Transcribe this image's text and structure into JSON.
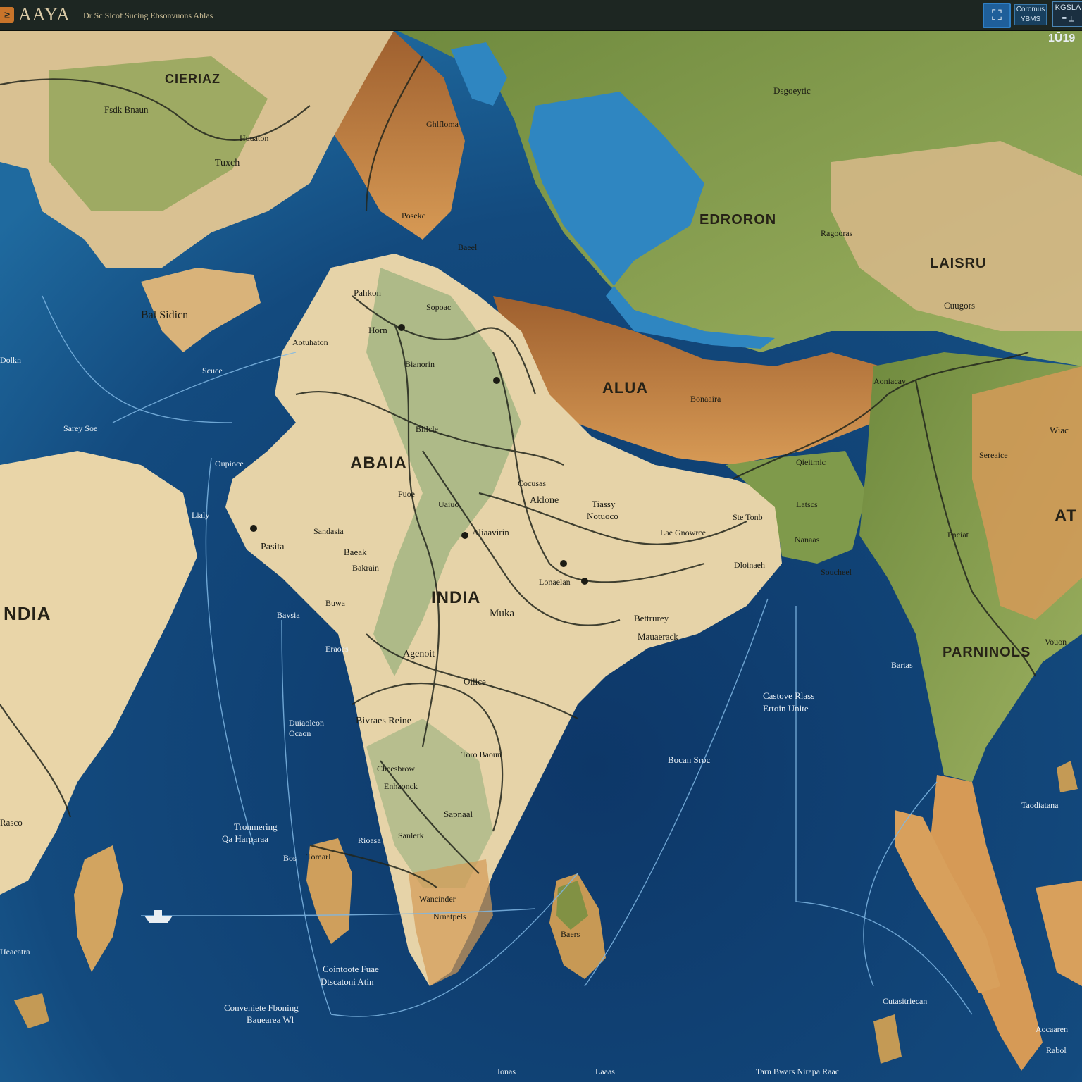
{
  "header": {
    "logo_glyph": "≥",
    "title": "AAYA",
    "subtitle": "Dr Sc Sicof Sucing Ebsonvuons Ahlas",
    "tool_glyph": "⛶",
    "chip_1_label": "Coromus\nYBMS",
    "chip_2_label": "KGSLA\n≡ ⟂",
    "zoom_readout": "1Ū19"
  },
  "map": {
    "colors": {
      "ocean_deep": "#0f3b6a",
      "ocean_shallow": "#2f86c1",
      "land_tan": "#e6d3a8",
      "land_green": "#7f9a4b",
      "mountain_brown": "#b5763d",
      "route_line": "#22261c",
      "sea_line": "#7fb7e4"
    },
    "major_labels": {
      "india_west": "NDIA",
      "india_main": "INDIA",
      "abaia": "ABAIA",
      "alua": "ALUA",
      "edroron": "EDRORON",
      "laisru": "LAISRU",
      "parninols": "PARNINOLS",
      "cieriaz": "CIERIAZ",
      "at": "AT"
    },
    "land_labels": [
      "Fsdk Bnaun",
      "Huuaton",
      "Tuxch",
      "Bal Sidicn",
      "Dsgoeytic",
      "Ragooras",
      "Cuugors",
      "Ghlfloma",
      "Posekc",
      "Baeel",
      "Pahkon",
      "Sopoac",
      "Horn",
      "Aotuhaton",
      "Bianorin",
      "Blilcle",
      "Cocusas",
      "Puoe",
      "Aklone",
      "Tiassy",
      "Notuoco",
      "Aliaavirin",
      "Uaiuo",
      "Lae Gnowrce",
      "Ste Tonb",
      "Sandasia",
      "Pasita",
      "Baeak",
      "Muka",
      "Bakrain",
      "Buwa",
      "Lonaelan",
      "Dloinaeh",
      "Bettrurey",
      "Mauaerack",
      "Agenoit",
      "Oilice",
      "Bivraes Reine",
      "Toro Baoun",
      "Cheesbrow",
      "Enhaonck",
      "Sapnaal",
      "Sanlerk",
      "Wancinder",
      "Nrnatpels",
      "Latscs",
      "Qieitmic",
      "Nanaas",
      "Fnciat",
      "Wiac",
      "Sereaice",
      "Vouon",
      "Bonaaira",
      "Aoniacay",
      "Soucheel",
      "Tomarl",
      "Baers",
      "Rasco"
    ],
    "sea_labels": [
      "Dolkn",
      "Sarey Soe",
      "Oupioce",
      "Lialy",
      "Bavsia",
      "Scuce",
      "Eraoes",
      "Bartas",
      "Castove Rlass",
      "Ertoin Unite",
      "Bocan Sroc",
      "Tarn Bwars Nirapa Raac",
      "Tronmering",
      "Qa Harparaa",
      "Bos",
      "Rioasa",
      "Ionas",
      "Heacatra",
      "Laaas",
      "Cointoote Fuae",
      "Dtscatoni Atin",
      "Conveniete Fboning",
      "Bauearea Wl",
      "Duiaoleon",
      "Ocaon",
      "Taodiatana",
      "Aocaaren",
      "Cutasitriecan",
      "Rabol"
    ]
  }
}
